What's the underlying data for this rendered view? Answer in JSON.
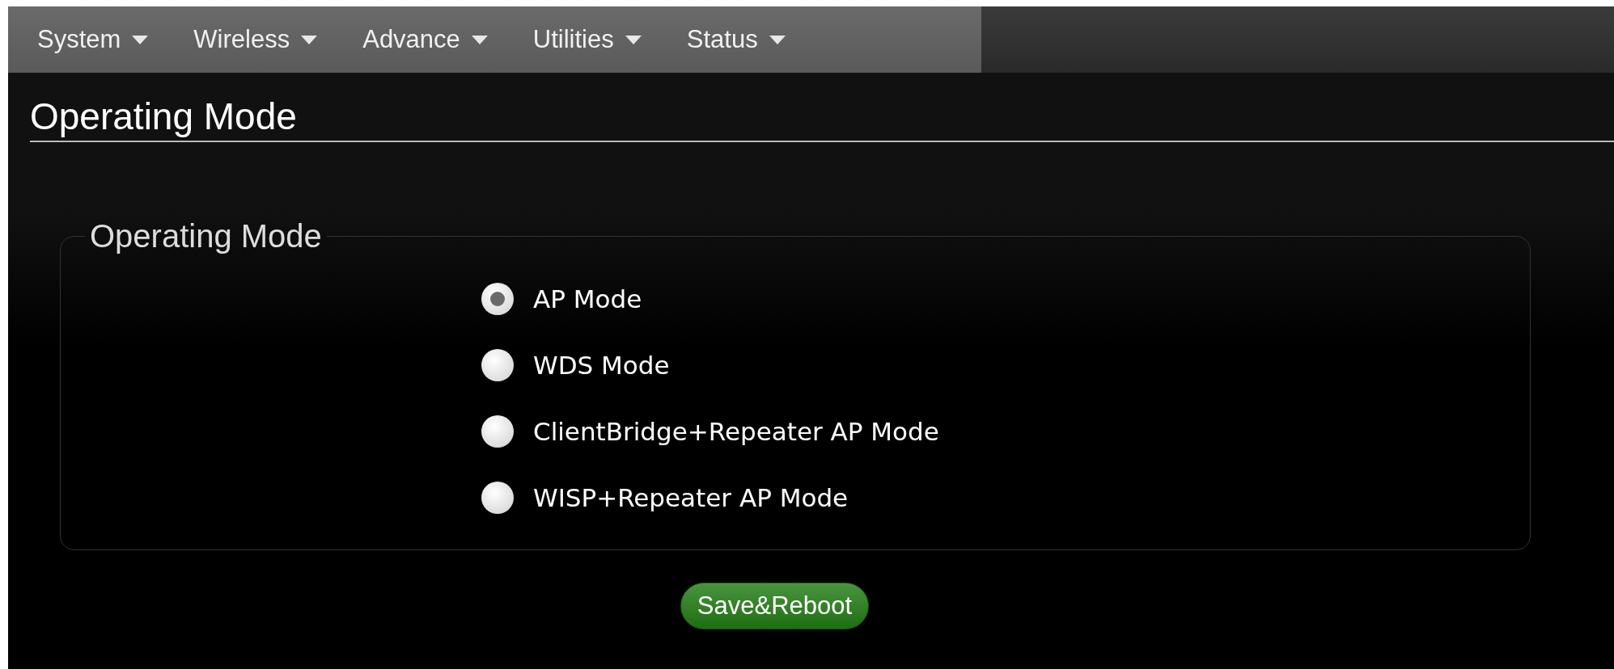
{
  "menu": [
    {
      "label": "System"
    },
    {
      "label": "Wireless"
    },
    {
      "label": "Advance"
    },
    {
      "label": "Utilities"
    },
    {
      "label": "Status"
    }
  ],
  "page_title": "Operating Mode",
  "fieldset": {
    "legend": "Operating Mode",
    "options": [
      {
        "label": "AP Mode",
        "selected": true
      },
      {
        "label": "WDS Mode",
        "selected": false
      },
      {
        "label": "ClientBridge+Repeater AP Mode",
        "selected": false
      },
      {
        "label": "WISP+Repeater AP Mode",
        "selected": false
      }
    ]
  },
  "save_button": "Save&Reboot"
}
